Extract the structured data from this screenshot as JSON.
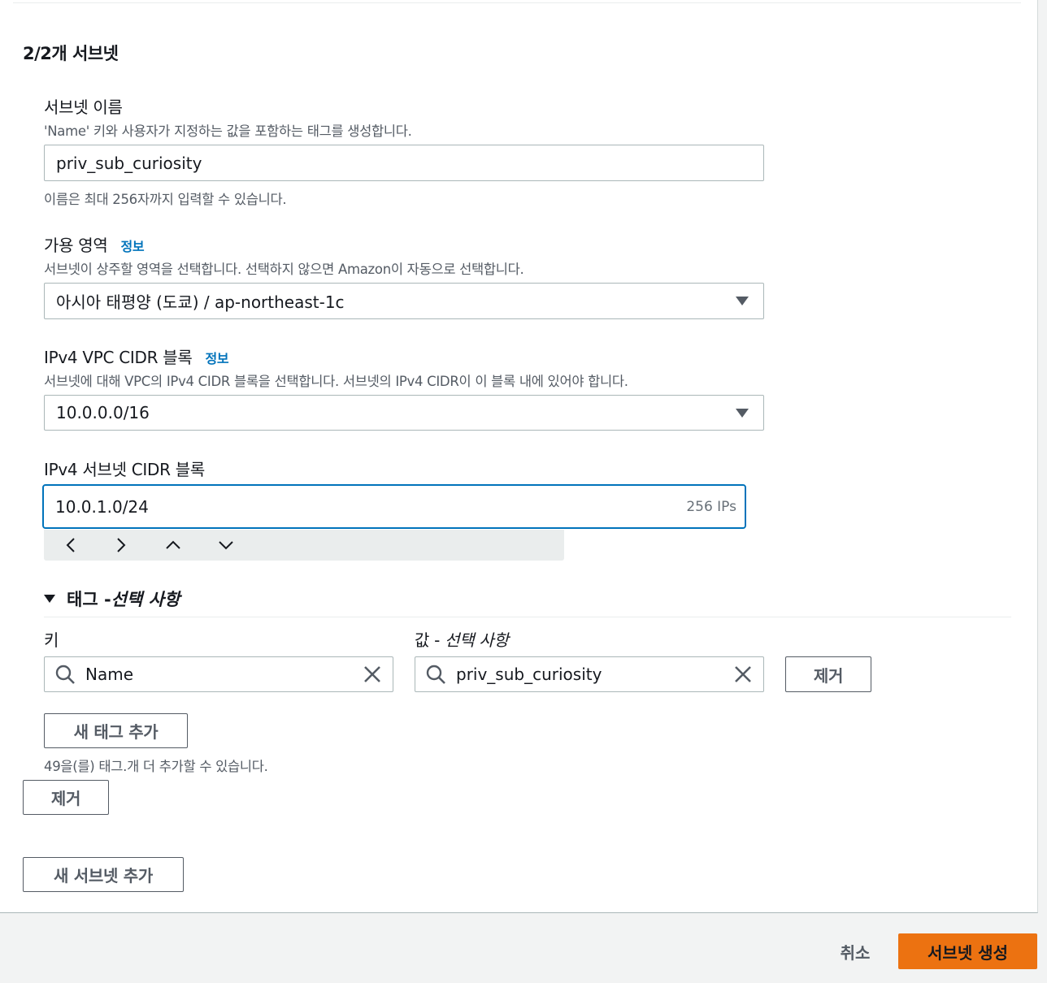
{
  "section": {
    "title": "2/2개 서브넷"
  },
  "subnet_name": {
    "label": "서브넷 이름",
    "description": "'Name' 키와 사용자가 지정하는 값을 포함하는 태그를 생성합니다.",
    "value": "priv_sub_curiosity",
    "hint": "이름은 최대 256자까지 입력할 수 있습니다."
  },
  "availability_zone": {
    "label": "가용 영역",
    "info": "정보",
    "description": "서브넷이 상주할 영역을 선택합니다. 선택하지 않으면 Amazon이 자동으로 선택합니다.",
    "value": "아시아 태평양 (도쿄) / ap-northeast-1c"
  },
  "vpc_cidr": {
    "label": "IPv4 VPC CIDR 블록",
    "info": "정보",
    "description": "서브넷에 대해 VPC의 IPv4 CIDR 블록을 선택합니다. 서브넷의 IPv4 CIDR이 이 블록 내에 있어야 합니다.",
    "value": "10.0.0.0/16"
  },
  "subnet_cidr": {
    "label": "IPv4 서브넷 CIDR 블록",
    "value": "10.0.1.0/24",
    "suffix": "256 IPs",
    "stepper_icons": [
      "chevron-left-icon",
      "chevron-right-icon",
      "chevron-up-icon",
      "chevron-down-icon"
    ]
  },
  "tags": {
    "header_prefix": "태그 - ",
    "header_optional": "선택 사항",
    "key_label": "키",
    "value_label_prefix": "값 - ",
    "value_label_optional": "선택 사항",
    "key_value": "Name",
    "value_value": "priv_sub_curiosity",
    "remove_label": "제거",
    "add_tag_label": "새 태그 추가",
    "remaining_text": "49을(를) 태그.개 더 추가할 수 있습니다."
  },
  "subnet_remove_label": "제거",
  "add_subnet_label": "새 서브넷 추가",
  "footer": {
    "cancel_label": "취소",
    "create_label": "서브넷 생성"
  },
  "colors": {
    "primary": "#ec7211",
    "link": "#0073bb",
    "focus": "#0073bb",
    "border": "#aab7b8"
  }
}
